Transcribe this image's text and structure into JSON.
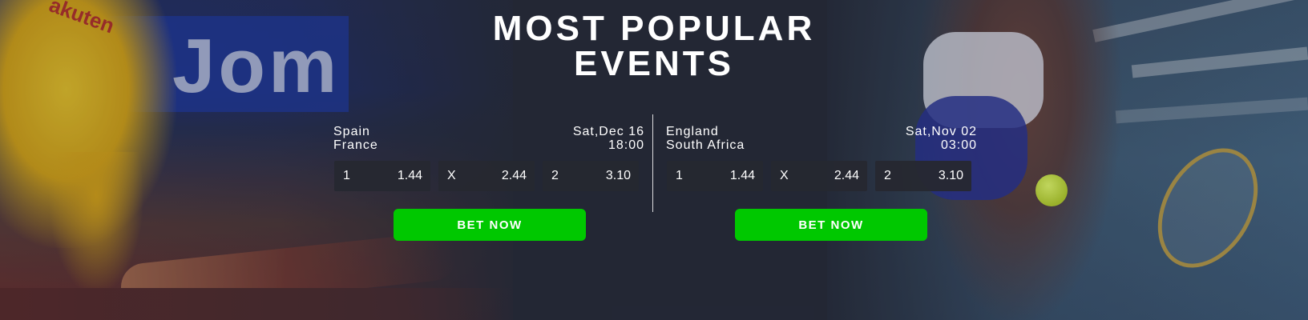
{
  "header": {
    "title_line1": "MOST POPULAR",
    "title_line2": "EVENTS"
  },
  "background": {
    "left_board_text": "Jom",
    "left_shirt_text": "akuten"
  },
  "events": [
    {
      "team1": "Spain",
      "team2": "France",
      "date": "Sat,Dec 16",
      "time": "18:00",
      "odds": [
        {
          "label": "1",
          "value": "1.44"
        },
        {
          "label": "X",
          "value": "2.44"
        },
        {
          "label": "2",
          "value": "3.10"
        }
      ],
      "button_label": "BET NOW"
    },
    {
      "team1": "England",
      "team2": "South Africa",
      "date": "Sat,Nov 02",
      "time": "03:00",
      "odds": [
        {
          "label": "1",
          "value": "1.44"
        },
        {
          "label": "X",
          "value": "2.44"
        },
        {
          "label": "2",
          "value": "3.10"
        }
      ],
      "button_label": "BET NOW"
    }
  ],
  "colors": {
    "button": "#00c800",
    "odd_box": "#262830",
    "background": "#262a38"
  }
}
